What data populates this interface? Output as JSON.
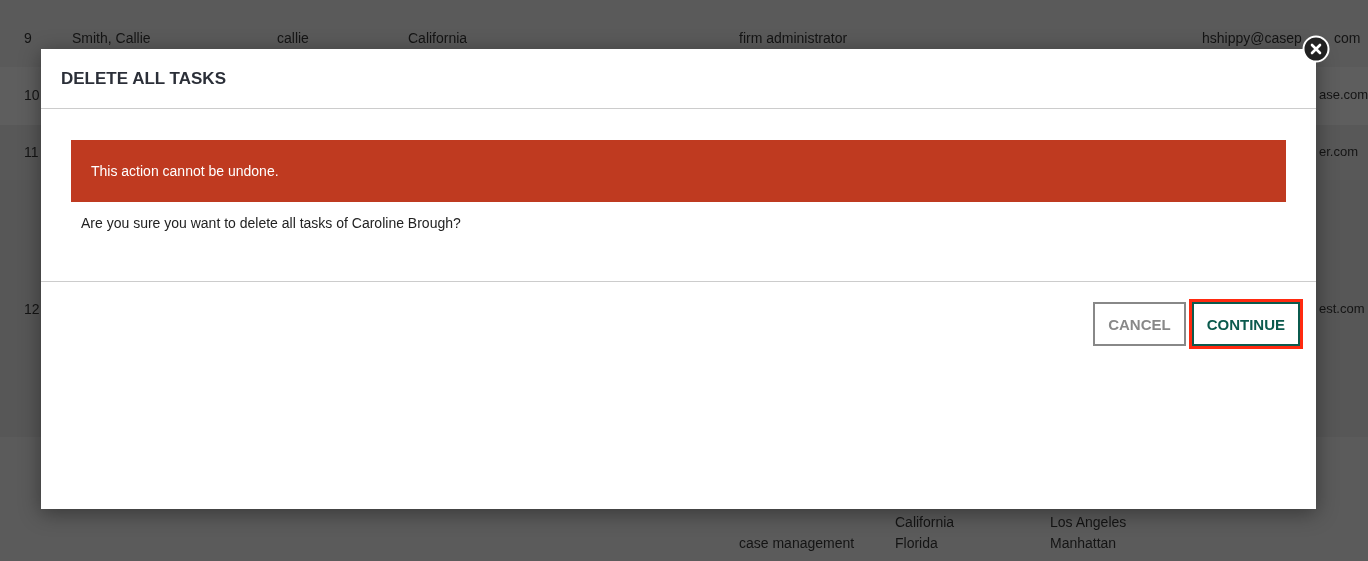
{
  "table": {
    "rows": [
      {
        "number": "9",
        "name": "Smith, Callie",
        "username": "callie",
        "state": "California",
        "role": "firm administrator",
        "email": "hshippy@casep",
        "email_end": "com"
      },
      {
        "number": "10",
        "email": "ase.com"
      },
      {
        "number": "11",
        "email": "er.com"
      },
      {
        "number": "12",
        "email": "est.com"
      },
      {
        "role": "case management",
        "states": [
          "California",
          "Florida"
        ],
        "cities": [
          "Los Angeles",
          "Manhattan"
        ]
      }
    ]
  },
  "dialog": {
    "title": "DELETE ALL TASKS",
    "alert": "This action cannot be undone.",
    "message": "Are you sure you want to delete all tasks of Caroline Brough?",
    "buttons": [
      {
        "label": "CANCEL",
        "kind": "secondary",
        "highlighted": false
      },
      {
        "label": "CONTINUE",
        "kind": "primary",
        "highlighted": true
      }
    ]
  }
}
